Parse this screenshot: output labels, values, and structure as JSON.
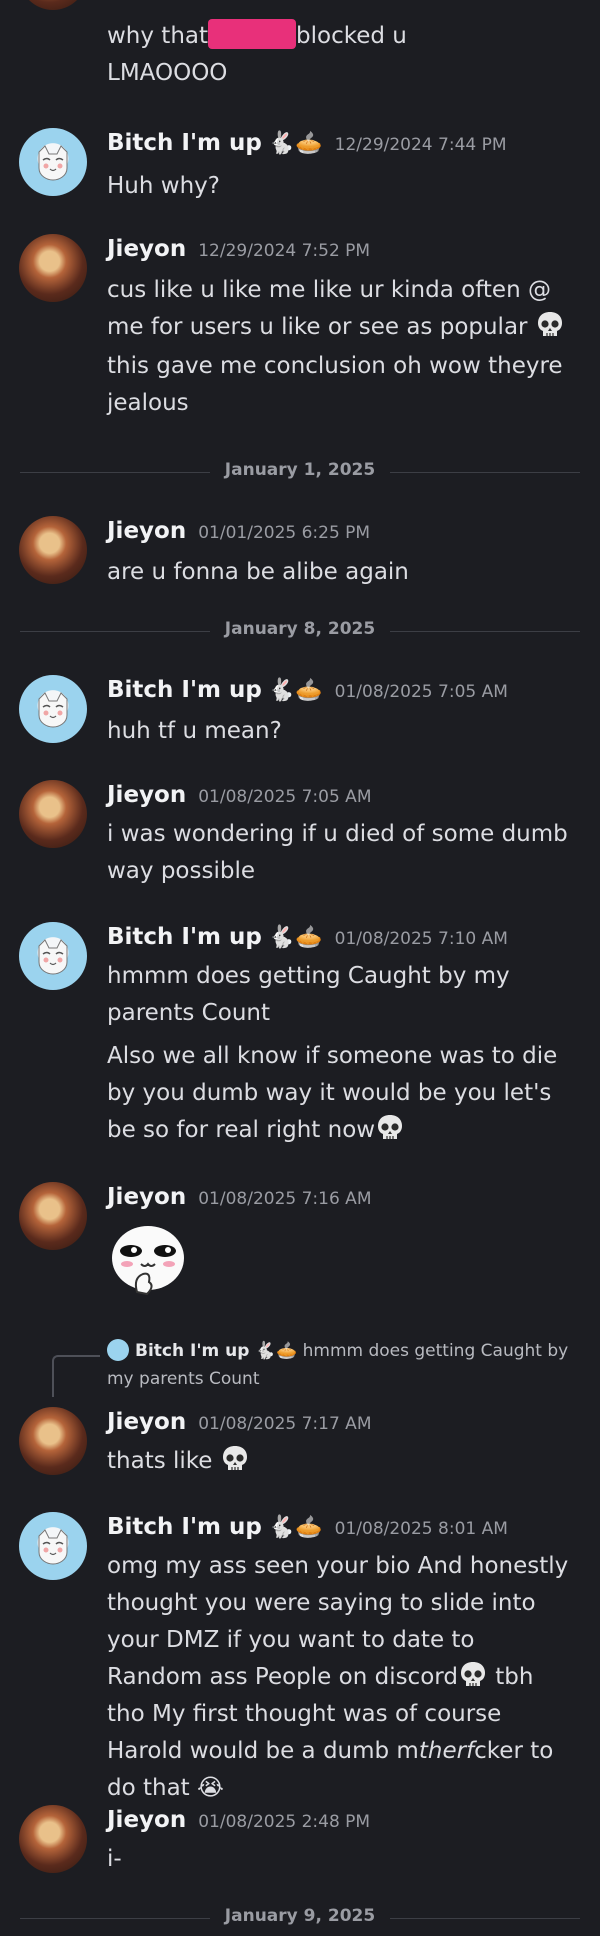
{
  "messages": [
    {
      "text_lines": [
        "why that",
        "blocked u",
        "LMAOOOO"
      ]
    },
    {
      "author": "Bitch I'm up",
      "emoji": "🐇🥧",
      "timestamp": "12/29/2024 7:44 PM",
      "text": "Huh why?"
    },
    {
      "author": "Jieyon",
      "timestamp": "12/29/2024 7:52 PM",
      "text": "cus like u like me like ur kinda often @ me for users u like or see as popular",
      "text2": "this gave me conclusion oh wow theyre jealous"
    },
    {
      "author": "Jieyon",
      "timestamp": "01/01/2025 6:25 PM",
      "text": "are u fonna be alibe again"
    },
    {
      "author": "Bitch I'm up",
      "emoji": "🐇🥧",
      "timestamp": "01/08/2025 7:05 AM",
      "text": "huh tf u mean?"
    },
    {
      "author": "Jieyon",
      "timestamp": "01/08/2025 7:05 AM",
      "text": "i was wondering if u died of some dumb way possible"
    },
    {
      "author": "Bitch I'm up",
      "emoji": "🐇🥧",
      "timestamp": "01/08/2025 7:10 AM",
      "text": "hmmm does getting Caught by my parents Count",
      "text2": "Also we all know if someone was to die by you dumb way it would be you let's be so for real right now"
    },
    {
      "author": "Jieyon",
      "timestamp": "01/08/2025 7:16 AM"
    },
    {
      "author": "Jieyon",
      "timestamp": "01/08/2025 7:17 AM",
      "text": "thats like",
      "reply": {
        "author": "Bitch I'm up",
        "emoji": "🐇🥧",
        "text": "hmmm does getting Caught by my parents Count"
      }
    },
    {
      "author": "Bitch I'm up",
      "emoji": "🐇🥧",
      "timestamp": "01/08/2025 8:01 AM",
      "text": "omg my ass seen your bio And honestly thought you were saying to slide into your DMZ if you want to date to Random ass People on discord",
      "text_b": "tbh tho My first thought was of course Harold would be a dumb m",
      "text_italic": "therf",
      "text_c": "cker to do that"
    },
    {
      "author": "Jieyon",
      "timestamp": "01/08/2025 2:48 PM",
      "text": "i-"
    }
  ],
  "dividers": [
    "January 1, 2025",
    "January 8, 2025",
    "January 9, 2025"
  ],
  "colors": {
    "background": "#1c1d22",
    "redaction": "#e8307a"
  }
}
